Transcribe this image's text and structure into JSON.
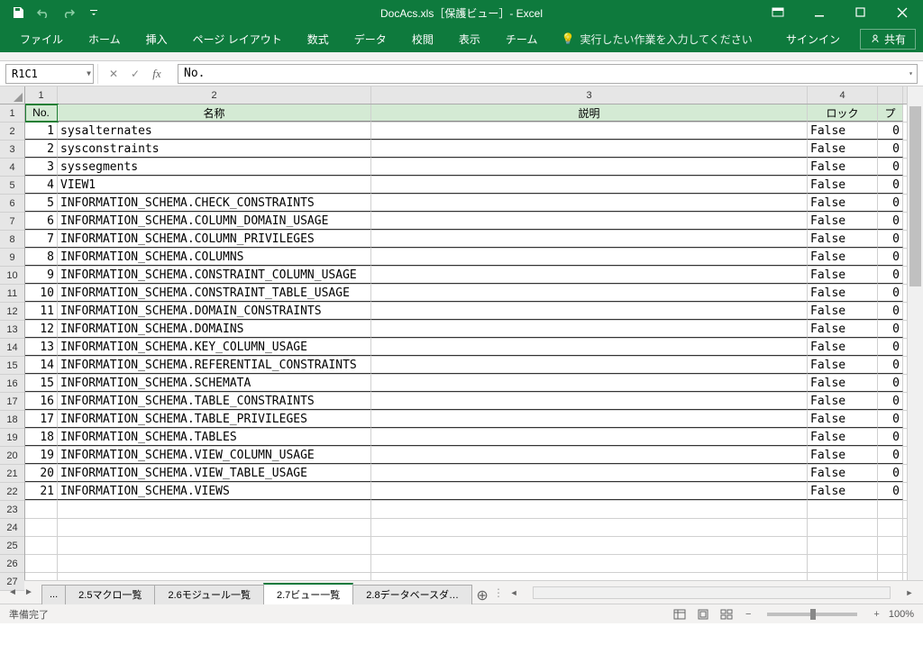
{
  "title": "DocAcs.xls［保護ビュー］- Excel",
  "ribbon": {
    "file": "ファイル",
    "home": "ホーム",
    "insert": "挿入",
    "layout": "ページ レイアウト",
    "formulas": "数式",
    "data": "データ",
    "review": "校閲",
    "view": "表示",
    "team": "チーム",
    "tellme": "実行したい作業を入力してください",
    "signin": "サインイン",
    "share": "共有"
  },
  "name_box": "R1C1",
  "formula_value": "No.",
  "col_labels": [
    "1",
    "2",
    "3",
    "4"
  ],
  "headers": {
    "no": "No.",
    "name": "名称",
    "desc": "説明",
    "lock": "ロック",
    "p": "プ"
  },
  "rows": [
    {
      "no": "1",
      "name": "sysalternates",
      "desc": "",
      "lock": "False",
      "z": "0"
    },
    {
      "no": "2",
      "name": "sysconstraints",
      "desc": "",
      "lock": "False",
      "z": "0"
    },
    {
      "no": "3",
      "name": "syssegments",
      "desc": "",
      "lock": "False",
      "z": "0"
    },
    {
      "no": "4",
      "name": "VIEW1",
      "desc": "",
      "lock": "False",
      "z": "0"
    },
    {
      "no": "5",
      "name": "INFORMATION_SCHEMA.CHECK_CONSTRAINTS",
      "desc": "",
      "lock": "False",
      "z": "0"
    },
    {
      "no": "6",
      "name": "INFORMATION_SCHEMA.COLUMN_DOMAIN_USAGE",
      "desc": "",
      "lock": "False",
      "z": "0"
    },
    {
      "no": "7",
      "name": "INFORMATION_SCHEMA.COLUMN_PRIVILEGES",
      "desc": "",
      "lock": "False",
      "z": "0"
    },
    {
      "no": "8",
      "name": "INFORMATION_SCHEMA.COLUMNS",
      "desc": "",
      "lock": "False",
      "z": "0"
    },
    {
      "no": "9",
      "name": "INFORMATION_SCHEMA.CONSTRAINT_COLUMN_USAGE",
      "desc": "",
      "lock": "False",
      "z": "0"
    },
    {
      "no": "10",
      "name": "INFORMATION_SCHEMA.CONSTRAINT_TABLE_USAGE",
      "desc": "",
      "lock": "False",
      "z": "0"
    },
    {
      "no": "11",
      "name": "INFORMATION_SCHEMA.DOMAIN_CONSTRAINTS",
      "desc": "",
      "lock": "False",
      "z": "0"
    },
    {
      "no": "12",
      "name": "INFORMATION_SCHEMA.DOMAINS",
      "desc": "",
      "lock": "False",
      "z": "0"
    },
    {
      "no": "13",
      "name": "INFORMATION_SCHEMA.KEY_COLUMN_USAGE",
      "desc": "",
      "lock": "False",
      "z": "0"
    },
    {
      "no": "14",
      "name": "INFORMATION_SCHEMA.REFERENTIAL_CONSTRAINTS",
      "desc": "",
      "lock": "False",
      "z": "0"
    },
    {
      "no": "15",
      "name": "INFORMATION_SCHEMA.SCHEMATA",
      "desc": "",
      "lock": "False",
      "z": "0"
    },
    {
      "no": "16",
      "name": "INFORMATION_SCHEMA.TABLE_CONSTRAINTS",
      "desc": "",
      "lock": "False",
      "z": "0"
    },
    {
      "no": "17",
      "name": "INFORMATION_SCHEMA.TABLE_PRIVILEGES",
      "desc": "",
      "lock": "False",
      "z": "0"
    },
    {
      "no": "18",
      "name": "INFORMATION_SCHEMA.TABLES",
      "desc": "",
      "lock": "False",
      "z": "0"
    },
    {
      "no": "19",
      "name": "INFORMATION_SCHEMA.VIEW_COLUMN_USAGE",
      "desc": "",
      "lock": "False",
      "z": "0"
    },
    {
      "no": "20",
      "name": "INFORMATION_SCHEMA.VIEW_TABLE_USAGE",
      "desc": "",
      "lock": "False",
      "z": "0"
    },
    {
      "no": "21",
      "name": "INFORMATION_SCHEMA.VIEWS",
      "desc": "",
      "lock": "False",
      "z": "0"
    }
  ],
  "sheet_tabs": {
    "ellipsis": "...",
    "t1": "2.5マクロ一覧",
    "t2": "2.6モジュール一覧",
    "t3": "2.7ビュー一覧",
    "t4": "2.8データベースダ…"
  },
  "status": {
    "ready": "準備完了",
    "zoom": "100%"
  }
}
